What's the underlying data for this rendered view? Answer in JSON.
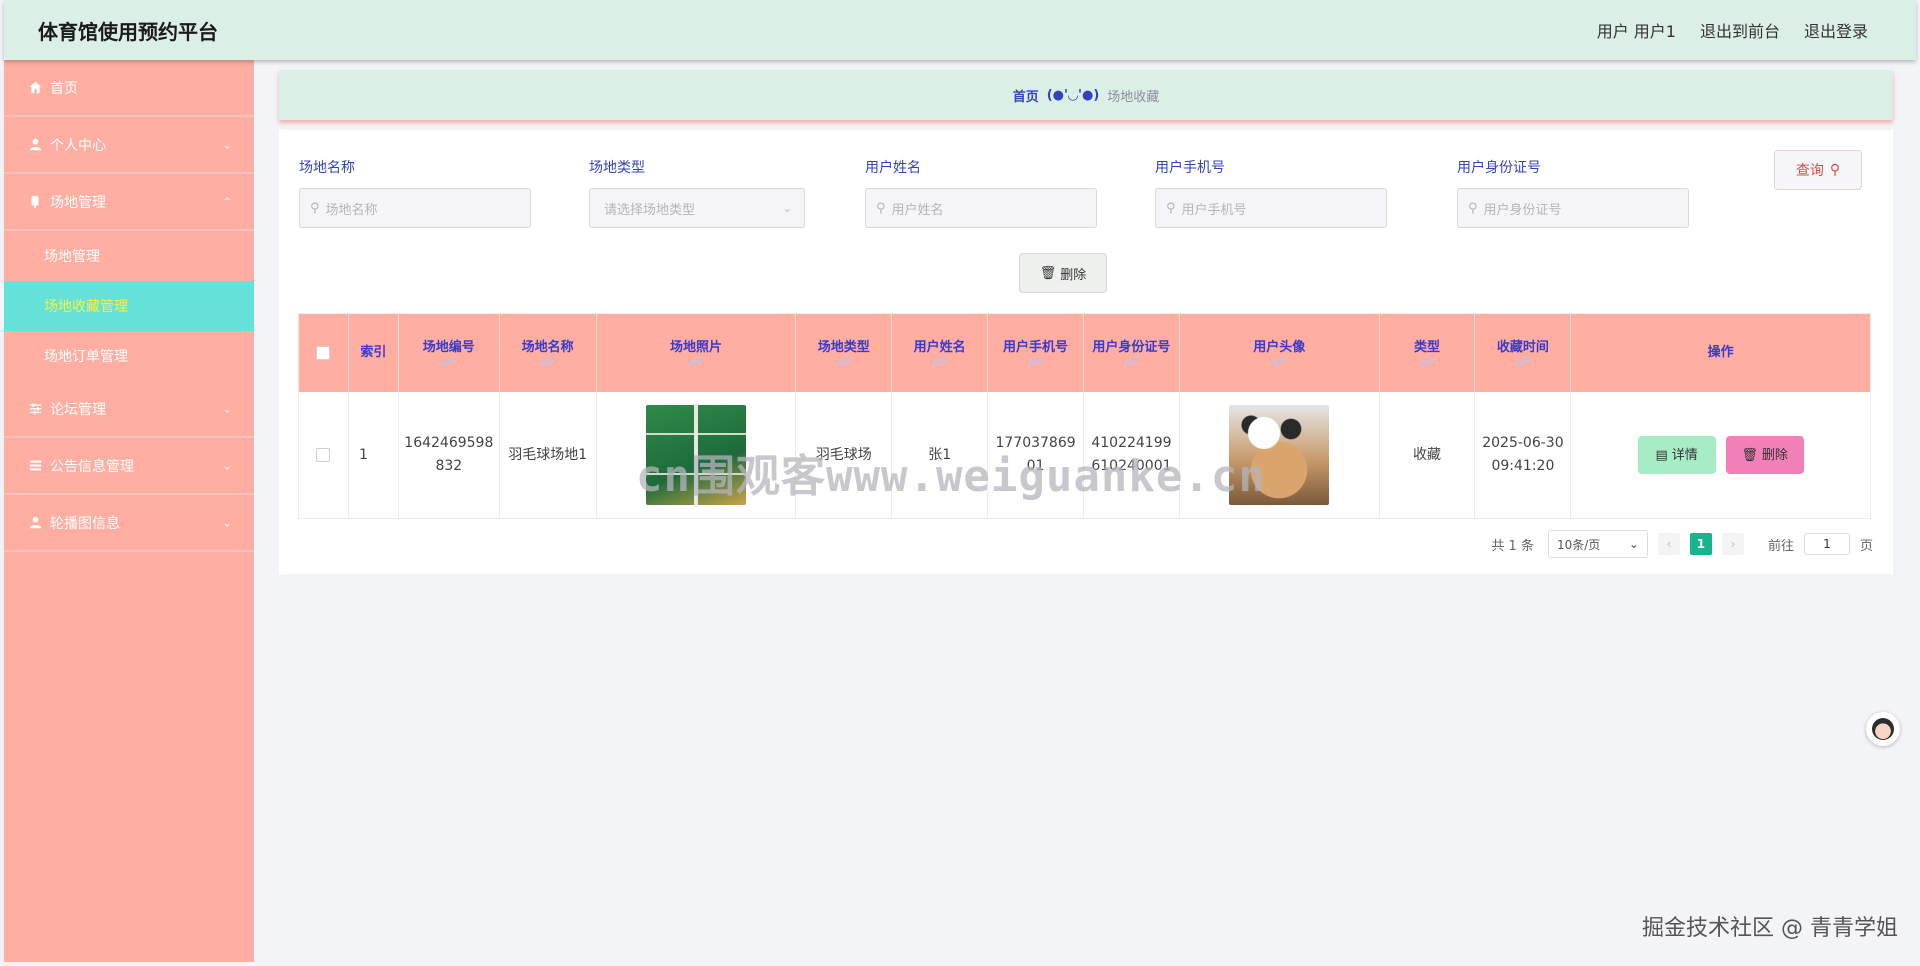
{
  "header": {
    "title": "体育馆使用预约平台",
    "user_label": "用户 用户1",
    "front_label": "退出到前台",
    "logout_label": "退出登录"
  },
  "sidebar": {
    "items": [
      {
        "label": "首页",
        "icon": "home-icon"
      },
      {
        "label": "个人中心",
        "icon": "user-icon"
      },
      {
        "label": "场地管理",
        "icon": "venue-icon"
      },
      {
        "label": "论坛管理",
        "icon": "sliders-icon"
      },
      {
        "label": "公告信息管理",
        "icon": "list-icon"
      },
      {
        "label": "轮播图信息",
        "icon": "user-icon"
      }
    ],
    "sub_items": [
      "场地管理",
      "场地收藏管理",
      "场地订单管理"
    ]
  },
  "breadcrumb": {
    "home": "首页",
    "separator": "(●'◡'●)",
    "current": "场地收藏"
  },
  "search": {
    "fields": [
      {
        "label": "场地名称",
        "placeholder": "场地名称"
      },
      {
        "label": "场地类型",
        "placeholder": "请选择场地类型"
      },
      {
        "label": "用户姓名",
        "placeholder": "用户姓名"
      },
      {
        "label": "用户手机号",
        "placeholder": "用户手机号"
      },
      {
        "label": "用户身份证号",
        "placeholder": "用户身份证号"
      }
    ],
    "query_label": "查询",
    "bulk_delete_label": "删除"
  },
  "table": {
    "headers": [
      "索引",
      "场地编号",
      "场地名称",
      "场地照片",
      "场地类型",
      "用户姓名",
      "用户手机号",
      "用户身份证号",
      "用户头像",
      "类型",
      "收藏时间",
      "操作"
    ],
    "rows": [
      {
        "index": "1",
        "venue_no": "1642469598832",
        "venue_name": "羽毛球场地1",
        "venue_type": "羽毛球场",
        "user_name": "张1",
        "phone": "17703786901",
        "id_card": "410224199610240001",
        "type": "收藏",
        "time": "2025-06-30 09:41:20",
        "detail_label": "详情",
        "delete_label": "删除"
      }
    ]
  },
  "pagination": {
    "total": "共 1 条",
    "page_size": "10条/页",
    "current_page": "1",
    "goto_label": "前往",
    "goto_value": "1",
    "page_suffix": "页"
  },
  "overlay": {
    "watermark": "cn围观客www.weiguanke.cn",
    "credit": "掘金技术社区 @ 青青学姐"
  },
  "colors": {
    "header_bg": "#dbefe6",
    "sidebar_bg": "#ffaea1",
    "active_bg": "#64e2da",
    "active_text": "#f7f13d",
    "table_head_bg": "#ffaea1",
    "detail_btn": "#a6ecc5",
    "delete_btn": "#f37fb8",
    "page_active": "#16b58e"
  }
}
